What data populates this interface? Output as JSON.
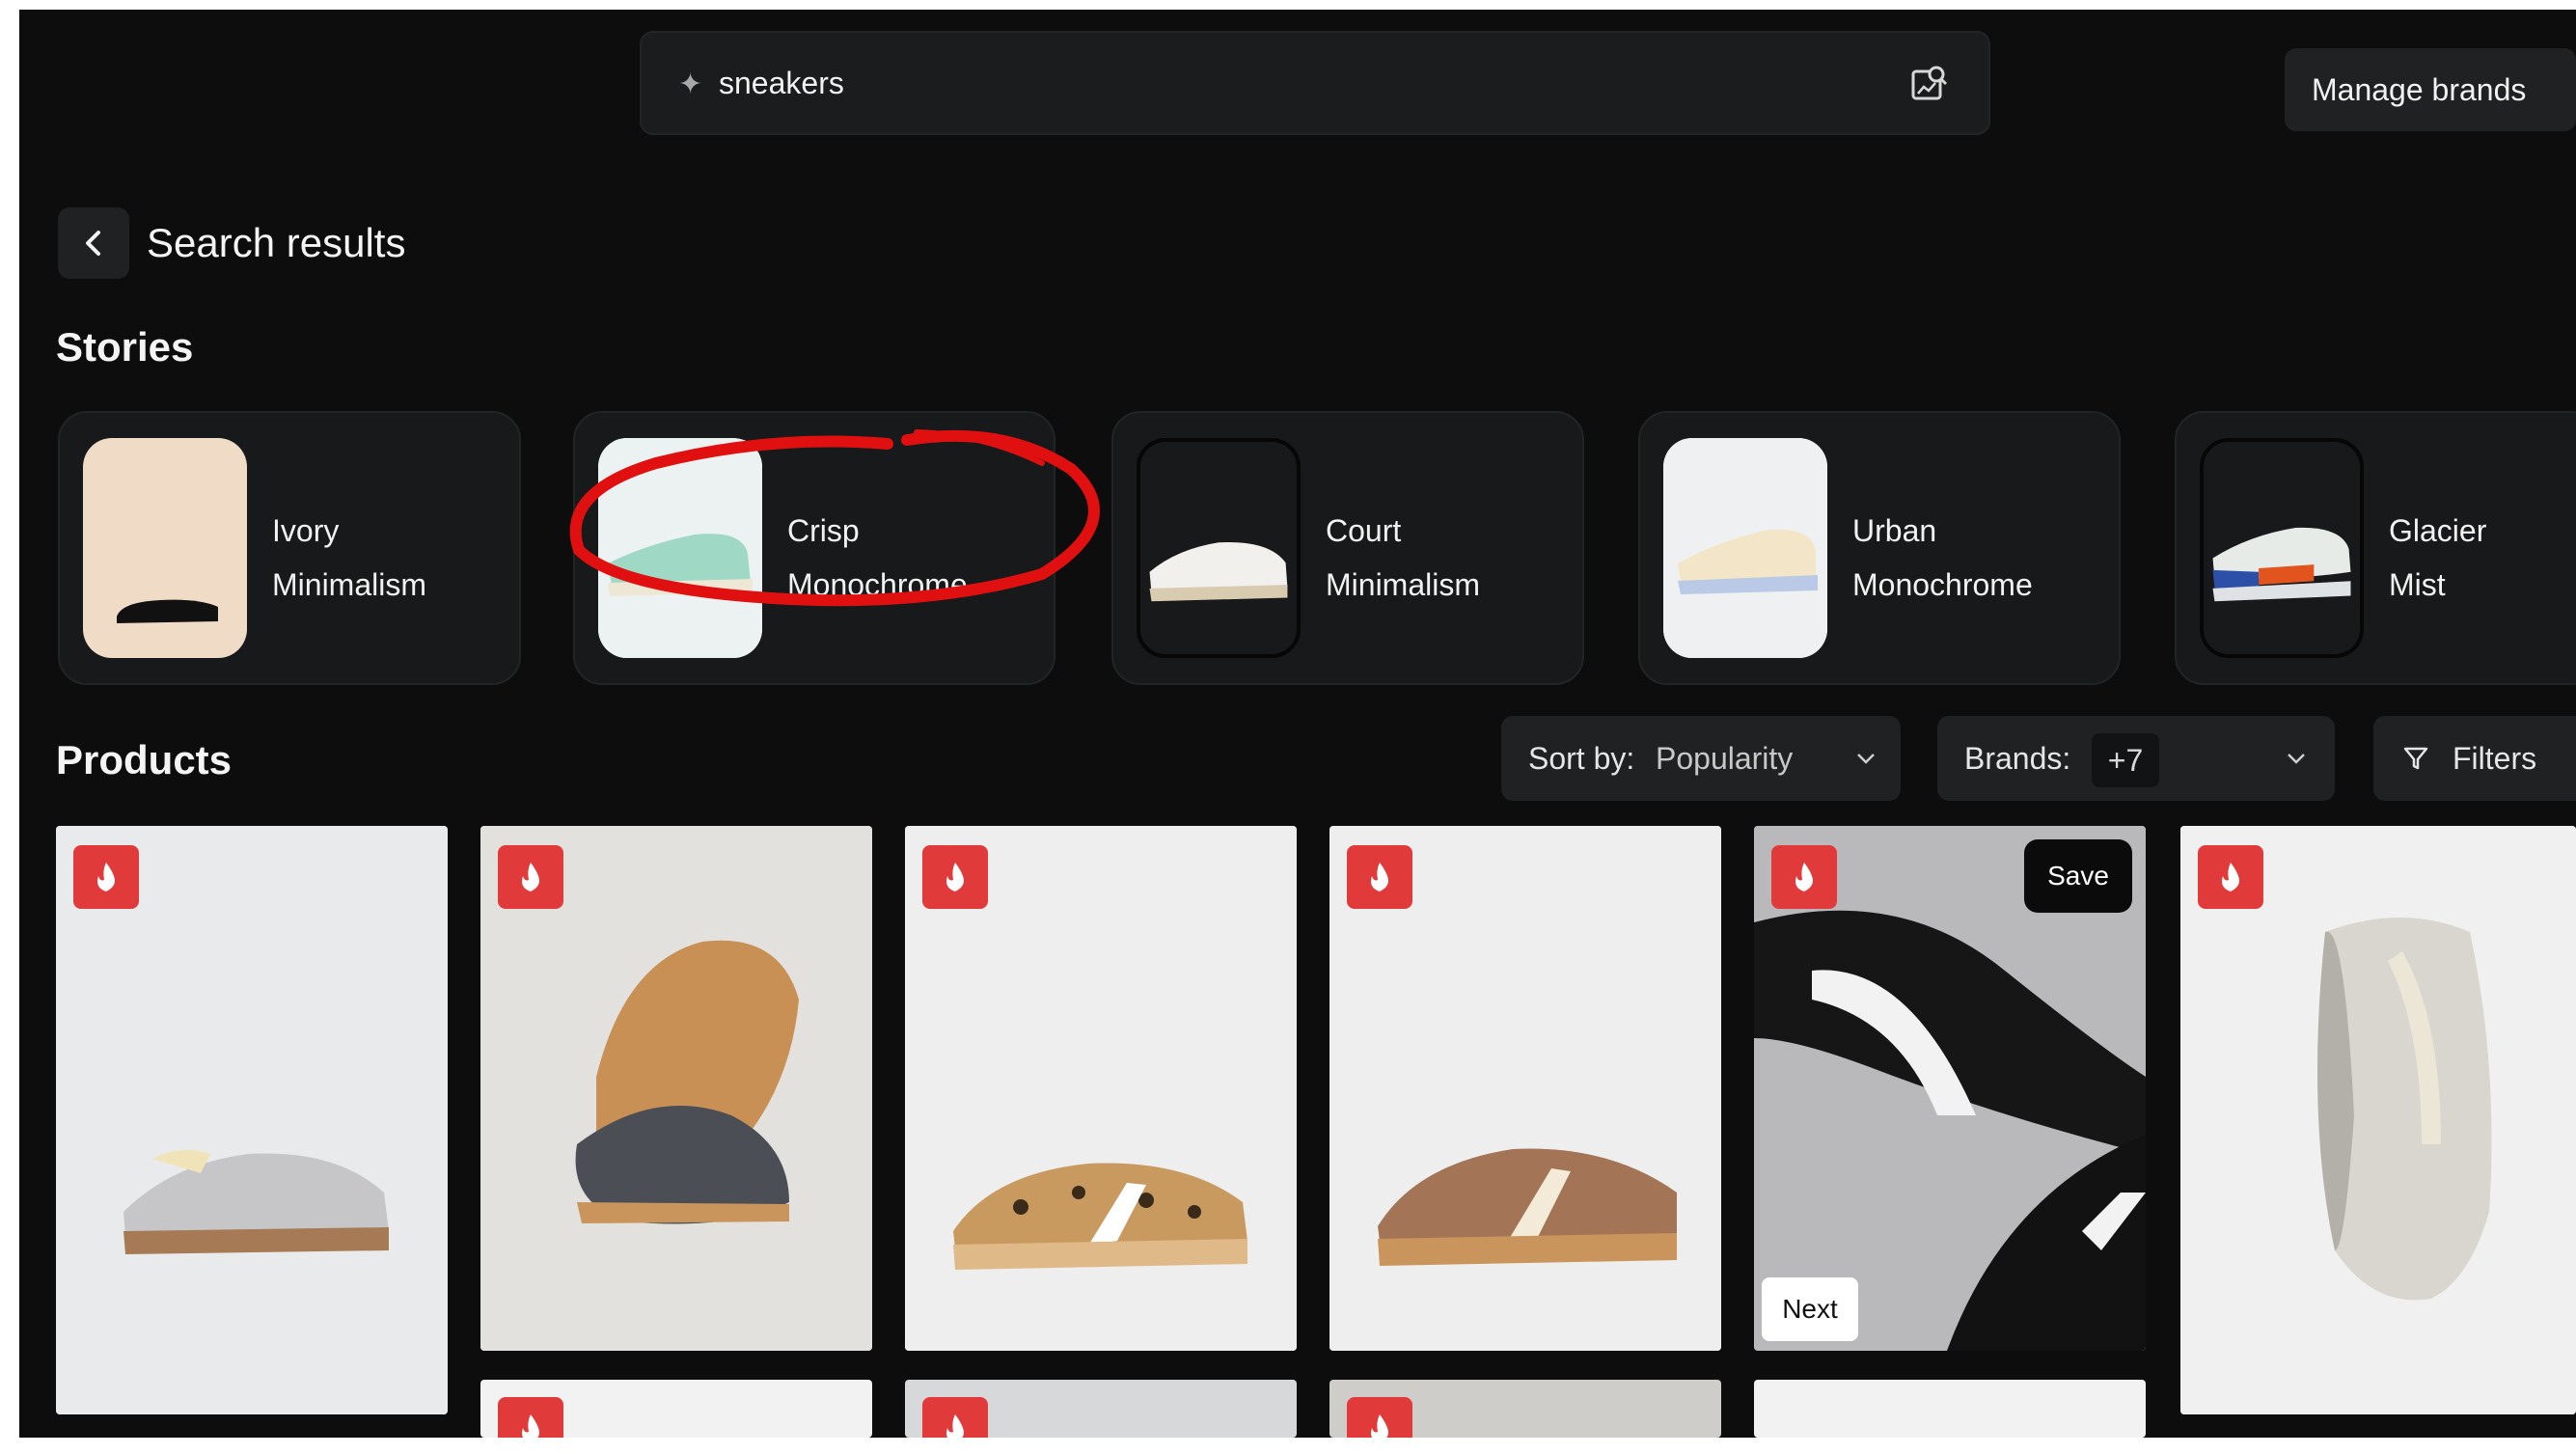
{
  "search": {
    "query": "sneakers",
    "sparkle_icon": "sparkle-icon",
    "image_search_icon": "image-search-icon"
  },
  "header": {
    "manage_brands_label": "Manage brands",
    "back_icon": "chevron-left-icon",
    "title": "Search results"
  },
  "stories": {
    "title": "Stories",
    "items": [
      {
        "line1": "Ivory",
        "line2": "Minimalism"
      },
      {
        "line1": "Crisp",
        "line2": "Monochrome"
      },
      {
        "line1": "Court",
        "line2": "Minimalism"
      },
      {
        "line1": "Urban",
        "line2": "Monochrome"
      },
      {
        "line1": "Glacier",
        "line2": "Mist"
      }
    ]
  },
  "products": {
    "title": "Products",
    "sort_label": "Sort by:",
    "sort_value": "Popularity",
    "brands_label": "Brands:",
    "brands_value": "+7",
    "filters_label": "Filters",
    "save_label": "Save",
    "next_label": "Next",
    "badge_icon": "flame-icon"
  },
  "colors": {
    "background": "#0d0d0d",
    "surface": "#1f2122",
    "badge": "#e03a3a",
    "annotation": "#e01010"
  }
}
